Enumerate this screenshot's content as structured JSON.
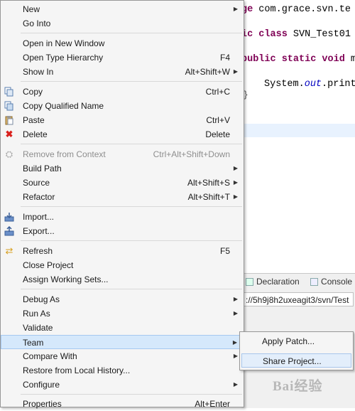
{
  "editor": {
    "line1_a": "ge",
    "line1_b": " com.grace.svn.te",
    "line2_a": "ic class",
    "line2_b": " SVN_Test01 ",
    "line3_a": "public static void",
    "line3_b": " m",
    "line4_a": "System.",
    "line4_b": "out",
    "line4_c": ".print",
    "brace": "}"
  },
  "bottom_panel": {
    "tab_declaration": "Declaration",
    "tab_console": "Console",
    "url": "://5h9j8h2uxeagit3/svn/Test"
  },
  "watermark": "Bai经验",
  "context_menu": {
    "new": "New",
    "go_into": "Go Into",
    "open_in_new_window": "Open in New Window",
    "open_type_hierarchy": "Open Type Hierarchy",
    "open_type_hierarchy_sc": "F4",
    "show_in": "Show In",
    "show_in_sc": "Alt+Shift+W",
    "copy": "Copy",
    "copy_sc": "Ctrl+C",
    "copy_qualified_name": "Copy Qualified Name",
    "paste": "Paste",
    "paste_sc": "Ctrl+V",
    "delete": "Delete",
    "delete_sc": "Delete",
    "remove_from_context": "Remove from Context",
    "remove_from_context_sc": "Ctrl+Alt+Shift+Down",
    "build_path": "Build Path",
    "source": "Source",
    "source_sc": "Alt+Shift+S",
    "refactor": "Refactor",
    "refactor_sc": "Alt+Shift+T",
    "import": "Import...",
    "export": "Export...",
    "refresh": "Refresh",
    "refresh_sc": "F5",
    "close_project": "Close Project",
    "assign_working_sets": "Assign Working Sets...",
    "debug_as": "Debug As",
    "run_as": "Run As",
    "validate": "Validate",
    "team": "Team",
    "compare_with": "Compare With",
    "restore_from_local_history": "Restore from Local History...",
    "configure": "Configure",
    "properties": "Properties",
    "properties_sc": "Alt+Enter"
  },
  "team_submenu": {
    "apply_patch": "Apply Patch...",
    "share_project": "Share Project..."
  },
  "icons": {
    "copy": "copy-icon",
    "copy_qualified_name": "copy-qualified-name-icon",
    "paste": "paste-icon",
    "delete": "delete-icon",
    "remove_from_context": "remove-from-context-icon",
    "import": "import-icon",
    "export": "export-icon",
    "refresh": "refresh-icon"
  },
  "colors": {
    "menu_bg": "#f5f5f5",
    "active_item": "#d5e8fb",
    "keyword": "#7f0055",
    "delete_icon": "#d9201c"
  }
}
